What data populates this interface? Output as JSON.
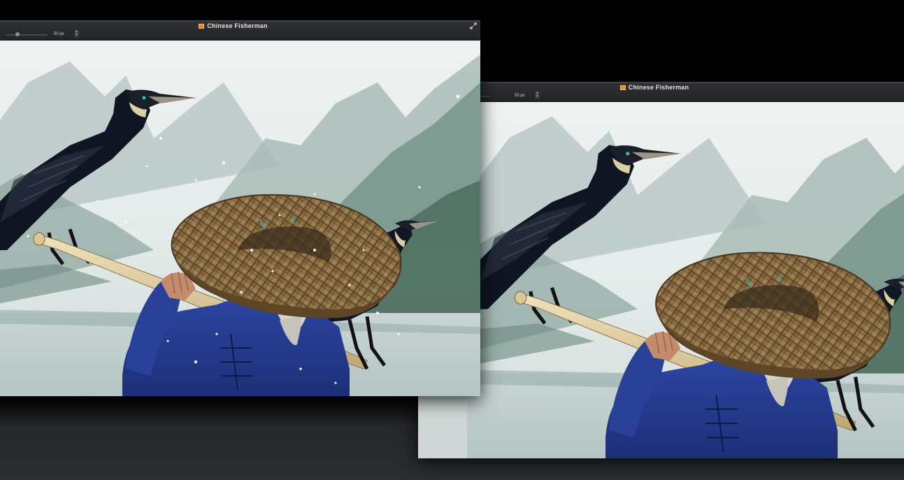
{
  "windows": {
    "front": {
      "title": "Chinese Fisherman",
      "brush_size": "50 px"
    },
    "back": {
      "title": "Chinese Fisherman",
      "brush_size": "50 px"
    }
  },
  "icons": {
    "document": "document-icon",
    "expand": "expand-icon",
    "stepper": "stepper-icon"
  },
  "colors": {
    "desktop_top": "#000000",
    "desktop_bottom": "#2b2d31",
    "titlebar": "#2e3034",
    "title_text": "#e6e6e6",
    "doc_icon": "#e3892b"
  }
}
